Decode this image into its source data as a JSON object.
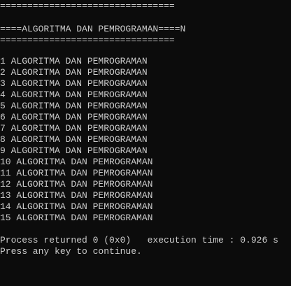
{
  "console": {
    "separator_top": "================================",
    "header": "====ALGORITMA DAN PEMROGRAMAN====N",
    "separator_bottom": "================================",
    "output_lines": [
      "1 ALGORITMA DAN PEMROGRAMAN",
      "2 ALGORITMA DAN PEMROGRAMAN",
      "3 ALGORITMA DAN PEMROGRAMAN",
      "4 ALGORITMA DAN PEMROGRAMAN",
      "5 ALGORITMA DAN PEMROGRAMAN",
      "6 ALGORITMA DAN PEMROGRAMAN",
      "7 ALGORITMA DAN PEMROGRAMAN",
      "8 ALGORITMA DAN PEMROGRAMAN",
      "9 ALGORITMA DAN PEMROGRAMAN",
      "10 ALGORITMA DAN PEMROGRAMAN",
      "11 ALGORITMA DAN PEMROGRAMAN",
      "12 ALGORITMA DAN PEMROGRAMAN",
      "13 ALGORITMA DAN PEMROGRAMAN",
      "14 ALGORITMA DAN PEMROGRAMAN",
      "15 ALGORITMA DAN PEMROGRAMAN"
    ],
    "process_status": "Process returned 0 (0x0)   execution time : 0.926 s",
    "continue_prompt": "Press any key to continue."
  },
  "colors": {
    "background": "#0c0c0c",
    "text": "#cccccc"
  }
}
